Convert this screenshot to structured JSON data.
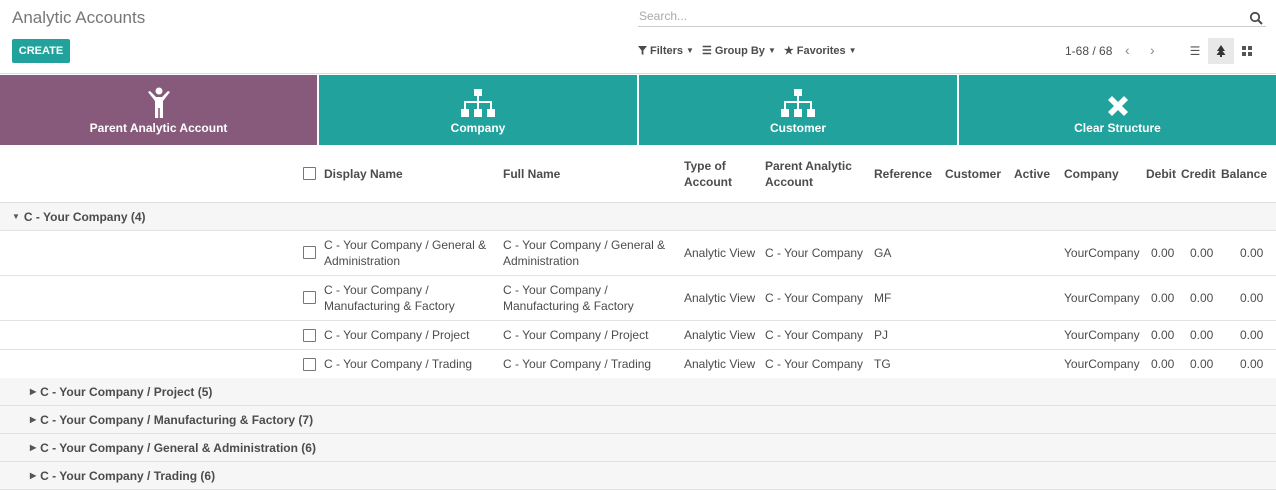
{
  "header": {
    "title": "Analytic Accounts",
    "search_placeholder": "Search...",
    "create_label": "CREATE",
    "filters_label": "Filters",
    "groupby_label": "Group By",
    "favorites_label": "Favorites",
    "pager": "1-68 / 68"
  },
  "structure_buttons": [
    {
      "label": "Parent Analytic Account",
      "color": "#875a7b",
      "icon": "person-icon"
    },
    {
      "label": "Company",
      "color": "#21a29c",
      "icon": "hierarchy-icon"
    },
    {
      "label": "Customer",
      "color": "#21a29c",
      "icon": "hierarchy-icon"
    },
    {
      "label": "Clear Structure",
      "color": "#21a29c",
      "icon": "close-icon"
    }
  ],
  "columns": {
    "display_name": "Display Name",
    "full_name": "Full Name",
    "type_l1": "Type of",
    "type_l2": "Account",
    "parent_l1": "Parent Analytic",
    "parent_l2": "Account",
    "reference": "Reference",
    "customer": "Customer",
    "active": "Active",
    "company": "Company",
    "debit": "Debit",
    "credit": "Credit",
    "balance": "Balance"
  },
  "group_open": "C - Your Company (4)",
  "rows": [
    {
      "display_l1": "C - Your Company / General &",
      "display_l2": "Administration",
      "full_l1": "C - Your Company / General &",
      "full_l2": "Administration",
      "type": "Analytic View",
      "parent": "C - Your Company",
      "ref": "GA",
      "company": "YourCompany",
      "debit": "0.00",
      "credit": "0.00",
      "balance": "0.00"
    },
    {
      "display_l1": "C - Your Company /",
      "display_l2": "Manufacturing & Factory",
      "full_l1": "C - Your Company /",
      "full_l2": "Manufacturing & Factory",
      "type": "Analytic View",
      "parent": "C - Your Company",
      "ref": "MF",
      "company": "YourCompany",
      "debit": "0.00",
      "credit": "0.00",
      "balance": "0.00"
    },
    {
      "display_l1": "C - Your Company / Project",
      "display_l2": "",
      "full_l1": "C - Your Company / Project",
      "full_l2": "",
      "type": "Analytic View",
      "parent": "C - Your Company",
      "ref": "PJ",
      "company": "YourCompany",
      "debit": "0.00",
      "credit": "0.00",
      "balance": "0.00"
    },
    {
      "display_l1": "C - Your Company / Trading",
      "display_l2": "",
      "full_l1": "C - Your Company / Trading",
      "full_l2": "",
      "type": "Analytic View",
      "parent": "C - Your Company",
      "ref": "TG",
      "company": "YourCompany",
      "debit": "0.00",
      "credit": "0.00",
      "balance": "0.00"
    }
  ],
  "sub_groups": [
    "C - Your Company / Project (5)",
    "C - Your Company / Manufacturing & Factory (7)",
    "C - Your Company / General & Administration (6)",
    "C - Your Company / Trading (6)"
  ]
}
